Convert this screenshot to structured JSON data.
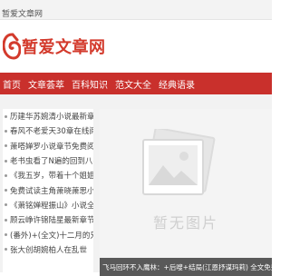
{
  "topbar": {
    "title": "暂爱文章网"
  },
  "logo": {
    "text": "暂爱文章网",
    "brand_color": "#d33a2c"
  },
  "nav": {
    "bg_color": "#c9302c",
    "items": [
      "首页",
      "文章荟萃",
      "百科知识",
      "范文大全",
      "经典语录"
    ]
  },
  "list": {
    "items": [
      "历建华苏婉清小说最新章节 历…",
      "春风不老爱天30章在线阅读 …",
      "萧嗒婵罗小说章节免费阅读 …",
      "老书虫看了N遍的回到八零我被…",
      "《我五岁，带着十个姐姐一起…",
      "免费试读主角萧晓萧思小说",
      "《萧铭婵程振山》小说全文精彩…",
      "顾云峥许锦陆星最新章节 全文…",
      "(番外)+(全文)十二月的兄没有…",
      "张大创胡婉柏人在乱世"
    ]
  },
  "feature": {
    "placeholder_text": "暂无图片",
    "caption": "飞马回环不入鹰林：+后嗖+结局(江恩抒谋玛莉) 全文免费阅读无弹窗大结局(飞马"
  }
}
